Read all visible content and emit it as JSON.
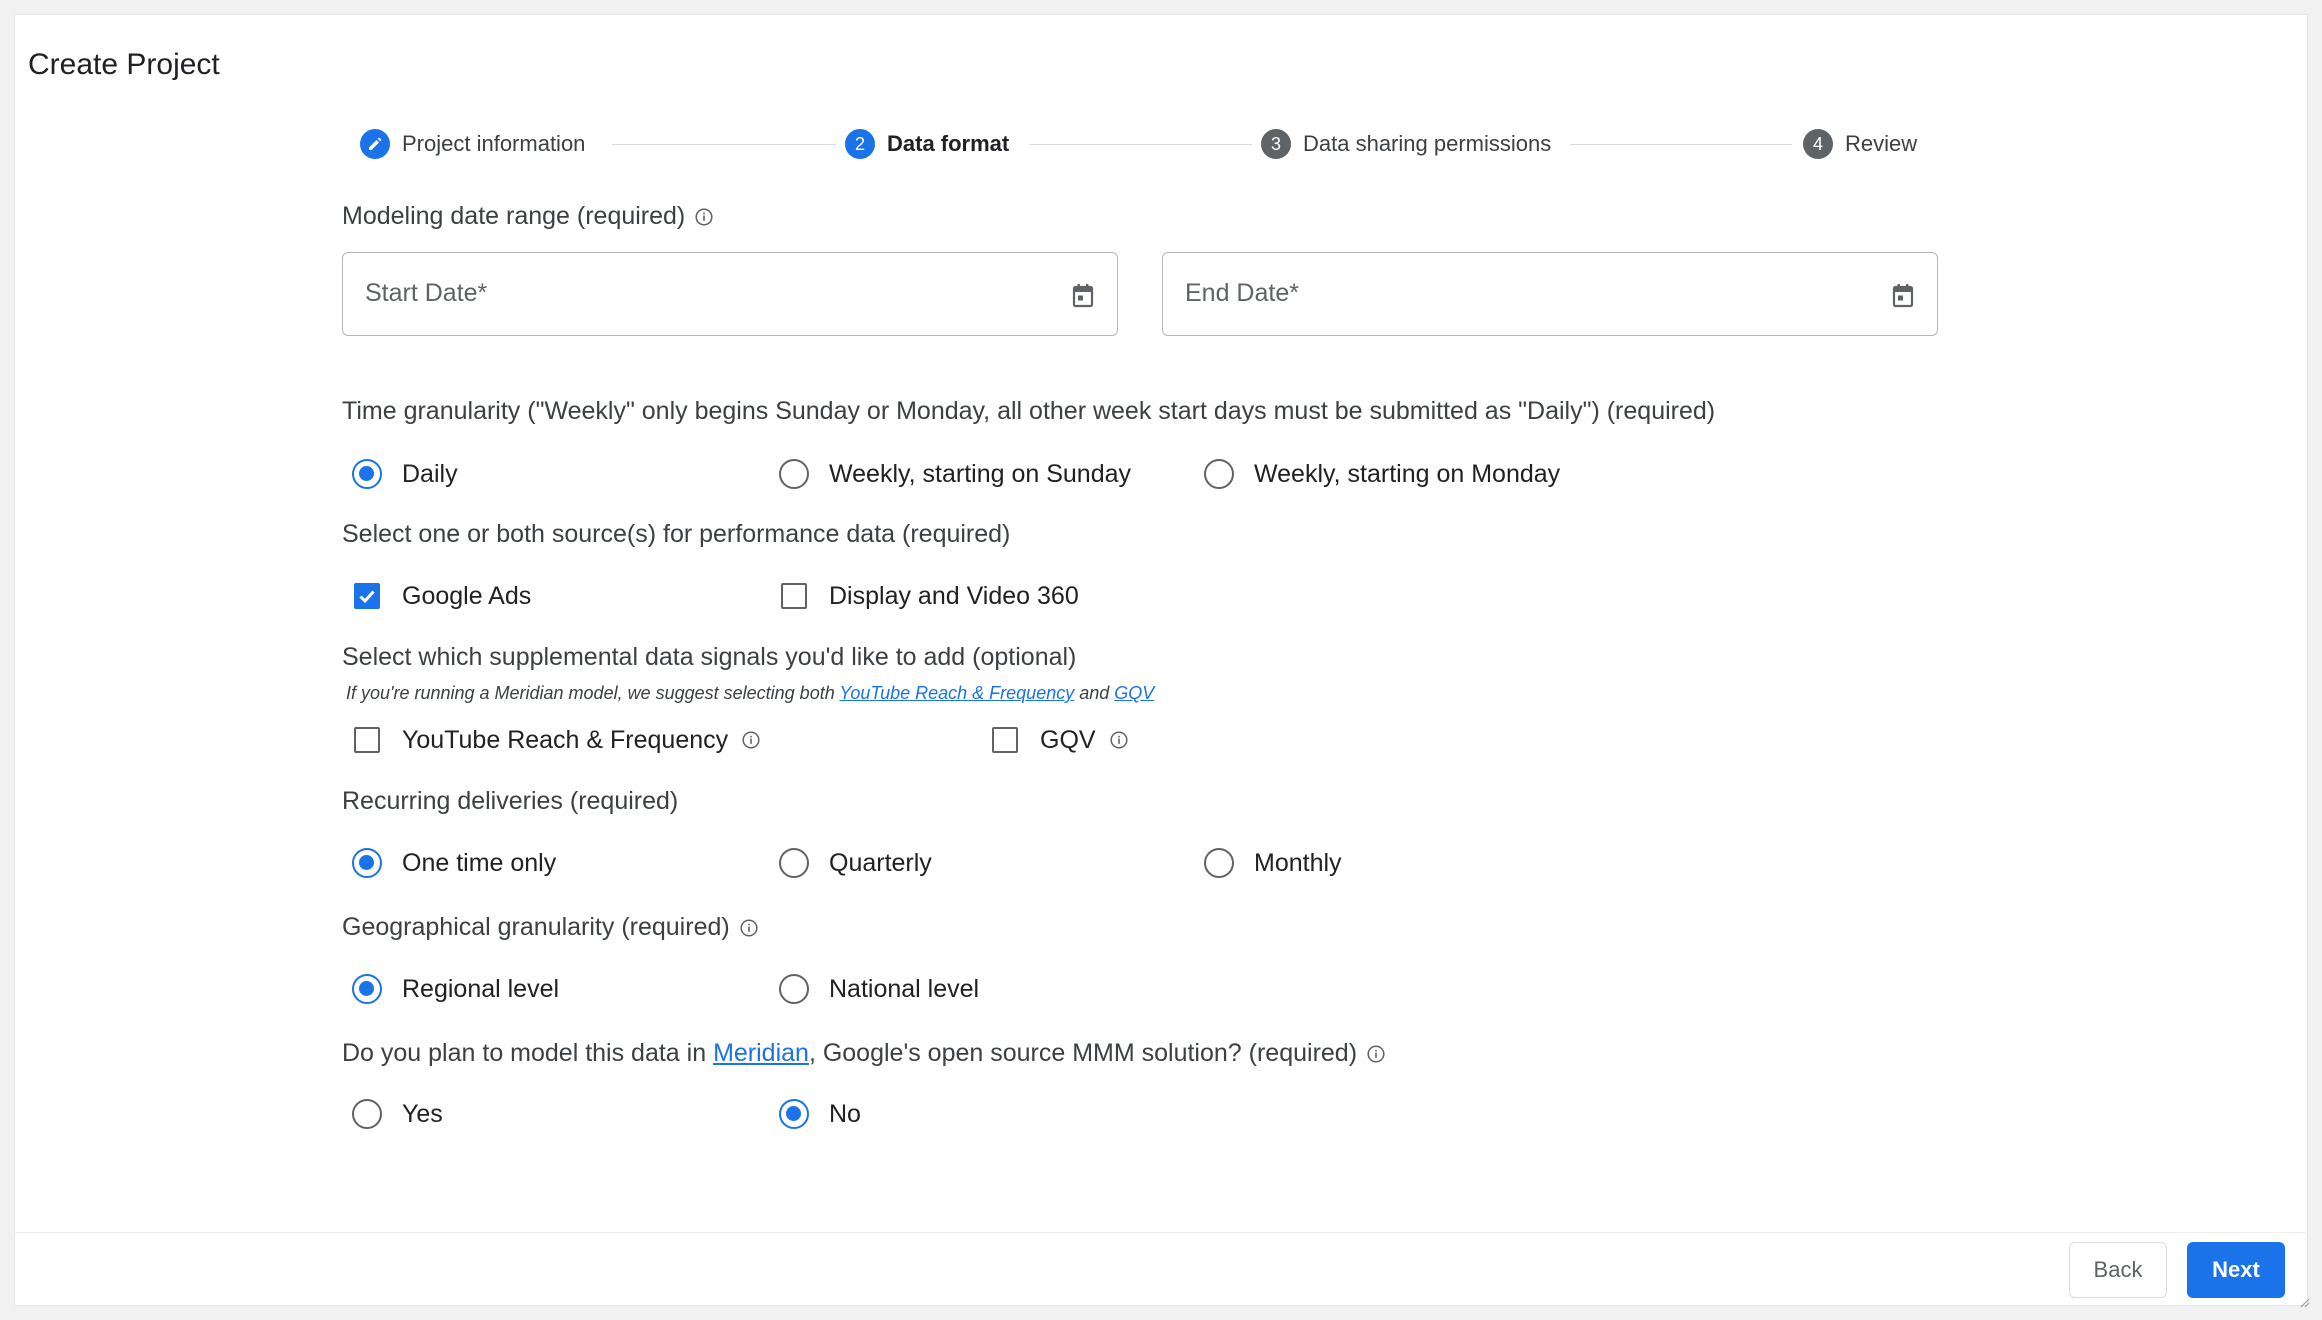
{
  "page": {
    "title": "Create Project"
  },
  "stepper": {
    "steps": [
      {
        "label": "Project information",
        "marker": "pencil-icon",
        "state": "completed"
      },
      {
        "label": "Data format",
        "marker": "2",
        "state": "active"
      },
      {
        "label": "Data sharing permissions",
        "marker": "3",
        "state": "upcoming"
      },
      {
        "label": "Review",
        "marker": "4",
        "state": "upcoming"
      }
    ]
  },
  "date_range": {
    "label": "Modeling date range (required)",
    "start_placeholder": "Start Date*",
    "end_placeholder": "End Date*"
  },
  "time_granularity": {
    "label": "Time granularity (\"Weekly\" only begins Sunday or Monday, all other week start days must be submitted as \"Daily\") (required)",
    "options": [
      "Daily",
      "Weekly, starting on Sunday",
      "Weekly, starting on Monday"
    ],
    "selected": "Daily"
  },
  "performance_sources": {
    "label": "Select one or both source(s) for performance data (required)",
    "options": [
      {
        "label": "Google Ads",
        "checked": true
      },
      {
        "label": "Display and Video 360",
        "checked": false
      }
    ]
  },
  "supplemental_signals": {
    "label": "Select which supplemental data signals you'd like to add (optional)",
    "hint_prefix": "If you're running a Meridian model, we suggest selecting both ",
    "hint_link1": "YouTube Reach & Frequency",
    "hint_and": " and ",
    "hint_link2": "GQV",
    "options": [
      {
        "label": "YouTube Reach & Frequency",
        "checked": false
      },
      {
        "label": "GQV",
        "checked": false
      }
    ]
  },
  "recurring": {
    "label": "Recurring deliveries (required)",
    "options": [
      "One time only",
      "Quarterly",
      "Monthly"
    ],
    "selected": "One time only"
  },
  "geo": {
    "label": "Geographical granularity (required)",
    "options": [
      "Regional level",
      "National level"
    ],
    "selected": "Regional level"
  },
  "meridian": {
    "label_prefix": "Do you plan to model this data in ",
    "label_link": "Meridian",
    "label_suffix": ", Google's open source MMM solution? (required)",
    "options": [
      "Yes",
      "No"
    ],
    "selected": "No"
  },
  "footer": {
    "back_label": "Back",
    "next_label": "Next"
  },
  "colors": {
    "accent": "#1a73e8",
    "step_grey": "#5f6368"
  }
}
